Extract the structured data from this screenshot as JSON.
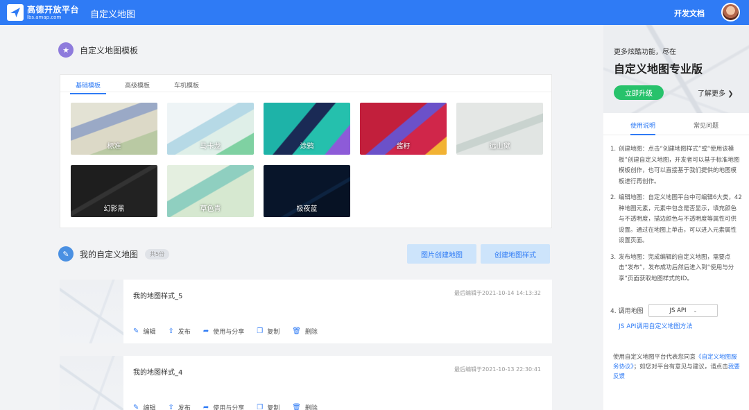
{
  "header": {
    "logo_title": "高德开放平台",
    "logo_subtitle": "lbs.amap.com",
    "app_title": "自定义地图",
    "doc_link": "开发文档"
  },
  "templates": {
    "section_title": "自定义地图模板",
    "tabs": [
      "基础模板",
      "高级模板",
      "车机模板"
    ],
    "active_tab": "基础模板",
    "items": [
      {
        "label": "标准",
        "color": "#d9dccd"
      },
      {
        "label": "马卡龙",
        "color": "#e6eff2"
      },
      {
        "label": "涂鸦",
        "color": "#2bb3a5"
      },
      {
        "label": "酱籽",
        "color": "#c4213e"
      },
      {
        "label": "远山黛",
        "color": "#dfe3e2"
      },
      {
        "label": "幻影黑",
        "color": "#242424"
      },
      {
        "label": "草色青",
        "color": "#d9ead5"
      },
      {
        "label": "极夜蓝",
        "color": "#0a1628"
      }
    ]
  },
  "my_maps": {
    "section_title": "我的自定义地图",
    "count_badge": "共5份",
    "image_create_button": "图片创建地图",
    "create_style_button": "创建地图样式",
    "actions": [
      "编辑",
      "发布",
      "使用与分享",
      "复制",
      "删除"
    ],
    "items": [
      {
        "name": "我的地图样式_5",
        "last_edited": "最后编辑于2021-10-14 14:13:32"
      },
      {
        "name": "我的地图样式_4",
        "last_edited": "最后编辑于2021-10-13 22:30:41"
      }
    ]
  },
  "sidebar": {
    "promo_line1": "更多炫酷功能，尽在",
    "promo_line2": "自定义地图专业版",
    "upgrade_button": "立即升级",
    "learn_more": "了解更多",
    "tabs": [
      "使用说明",
      "常见问题"
    ],
    "steps": [
      {
        "num": "1.",
        "text": "创建地图：点击“创建地图样式”或“使用该模板”创建自定义地图，开发者可以基于标准地图模板创作，也可以直接基于我们提供的地图模板进行再创作。"
      },
      {
        "num": "2.",
        "text": "编辑地图：自定义地图平台中可编辑6大类，42种地图元素，元素中包含是否显示，填充颜色与不透明度，描边颜色与不透明度等属性可供设置。通过在地图上单击，可以进入元素属性设置页面。"
      },
      {
        "num": "3.",
        "text": "发布地图：完成编辑的自定义地图，需要点击“发布”，发布成功后然后进入到“使用与分享”页面获取地图样式的ID。"
      }
    ],
    "call_label": "4. 调用地图",
    "call_select": "JS API",
    "api_link": "JS API调用自定义地图方法",
    "agree_prefix": "使用自定义地图平台代表您同意",
    "agree_link": "《自定义地图服务协议》",
    "agree_mid": "；如您对平台有意见与建议，请点击",
    "feedback_link": "我要反馈"
  }
}
